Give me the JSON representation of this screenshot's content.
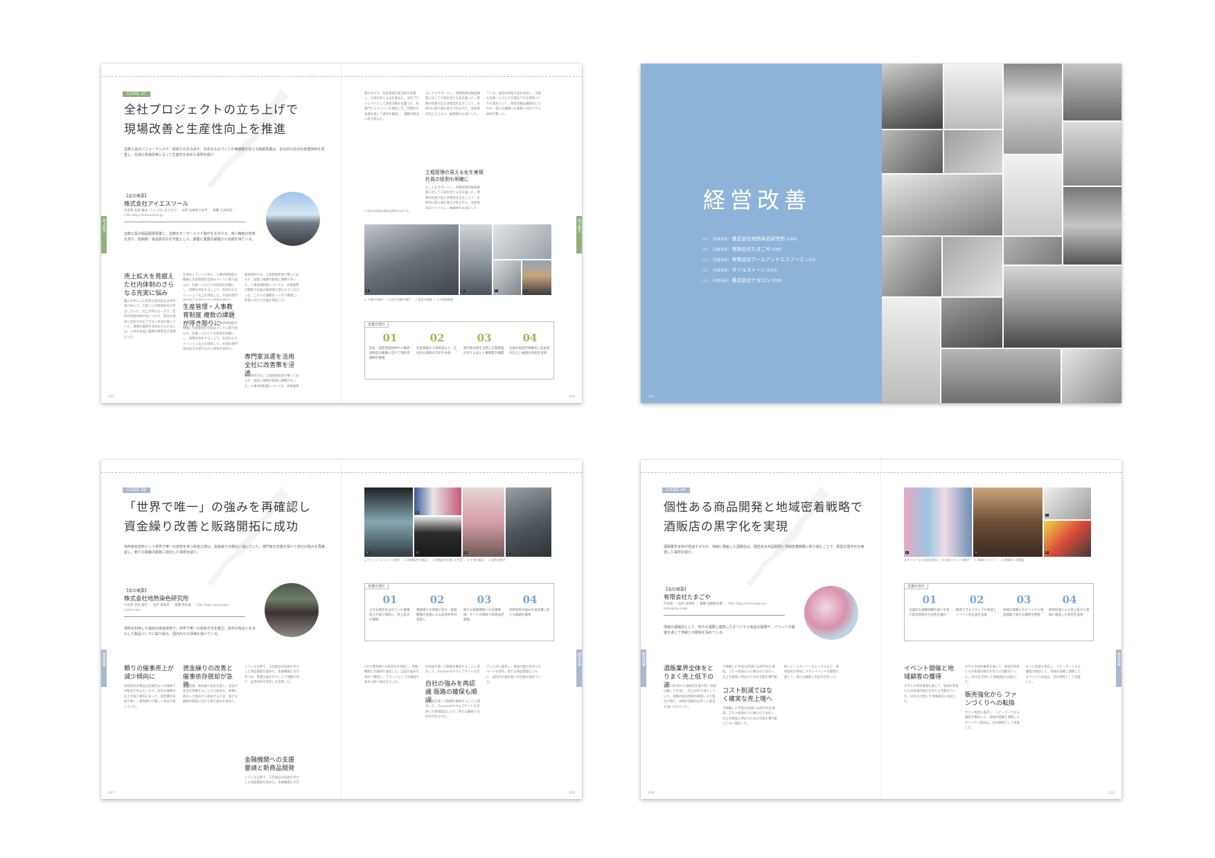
{
  "spread1": {
    "case_label": "CASE 37",
    "title_line1": "全社プロジェクトの立ち上げで",
    "title_line2": "現場改善と生産性向上を推進",
    "lead": "宝飾工具のパフォーマンスや、技術力の生み出す、日本のものづくりの価値観を伝える取組事業は、全社的な社内の管理体制を見直し、社員の意識改革によって生産性を高めた事例を紹介",
    "company_label": "【会社概要】",
    "company_name": "株式会社アイエスツール",
    "company_details": "代表者 石塚 雅永 / いしづか まさなが ｜ 住所 兵庫県三木市 ｜ 業種 工具製造 ｜ URL http://www.istool.jp",
    "business_desc": "宝飾工具の製品開発事業と、宝飾のオーダーメイド製作を手がける。高い精度の技術を誇り、短納期・高品質対応を可能とした。顧客に業務の顧客から信頼を得ている。",
    "heading_a": "売上拡大を見据えた社内体制のさらなる充実に悩み",
    "heading_b": "生産管理・人事教育制度 複数の課題が浮き彫りに",
    "heading_c": "専門家派遣を活用 全社に改善策を浸透",
    "heading_d": "工程管理の見える化を実現 社員の役割も明確に",
    "body_a": "職人の手による宝飾工具の組立は手作業が中心で、工程ごとの情報共有が不足していた。売上が伸びる一方で、社内の管理体制が追いつかず、受注の増加に生産が対応できない状況が続いていた。現場の業務を効率化するためには、人材の育成と業務の標準化が急務だった。",
    "body_b": "を伸ばしていくために、人事評価制度の整備と生産管理の仕組みづくりに取り組んだ。社員一人ひとりの役割を明確にし、目標を共有することで、社内のモチベーション向上を目指した。外部の専門家の助言を受けながら改善を進めた。",
    "body_c": "管理体制では、工程管理体制が整っておらず、品質と納期の管理に課題があった。人事評価制度についても、評価基準が曖昧で社員の納得感を得られていなかった。これらの課題を一つずつ整理し、改善に向けた計画を策定した。",
    "body_d": "進むなかで、生産管理の担当者を配置し、工程の見える化を進めた。全社プロジェクトとして改善活動を位置づけ、各部門からメンバーを選出した。定期的な会議を通じて進捗を確認し、課題の解決に取り組んだ。",
    "body_e": "ることもサポートし、現場改善の推進事業に対して工程の見える化を図った。現場の社員が自ら改善案を出すことで、主体的に取り組む風土が生まれた。生産性の向上とともに、納期遅れも減少した。",
    "body_f": "ている。会社の目指す姿を共有し、今後も社員一人ひとりが成長できる環境づくりを進めていく。改善活動は継続的に行われ、新たな課題にも柔軟に対応できる体制が整った。",
    "photo_caption": "A 工場内の様子 ｜ B 加工作業の様子 ｜ C 製品の検査 ｜ D 代表取締役",
    "footnote": "※本文の内容は取材当時のものです。",
    "flow_label": "支援の流れ",
    "steps": [
      {
        "num": "01",
        "text": "生産・品質管理体制や人事評価制度の整備に向けて現状の課題を整理"
      },
      {
        "num": "02",
        "text": "生産管理や人材育成など、全社的な取組の方針を共有"
      },
      {
        "num": "03",
        "text": "専門家派遣を活用し工程管理の見える化と人事制度を構築"
      },
      {
        "num": "04",
        "text": "社員の役割が明確化し生産性の向上と納期の改善を実現"
      }
    ],
    "side_tab_left": "売上拡大",
    "side_tab_right": "売上拡大",
    "page_left": "103",
    "page_right": "104"
  },
  "spread2": {
    "heading": "経営改善",
    "cases": [
      {
        "page": "107",
        "tag": "［事業事例］",
        "name": "株式会社地熱染色研究所",
        "pref": "青森県"
      },
      {
        "page": "109",
        "tag": "［事業事例］",
        "name": "有限会社たまごや",
        "pref": "長崎県"
      },
      {
        "page": "111",
        "tag": "［事業事例］",
        "name": "有限会社アールアンドエスフーズ",
        "pref": "山形県"
      },
      {
        "page": "113",
        "tag": "［事業事例］",
        "name": "サイルストーン",
        "pref": "熊本県"
      },
      {
        "page": "115",
        "tag": "［事業事例］",
        "name": "株式会社ナダロン",
        "pref": "愛知県"
      }
    ],
    "page_left": "105"
  },
  "spread3": {
    "case_label": "CASE 38",
    "title_line1": "「世界で唯一」の強みを再確認し",
    "title_line2": "資金繰り改善と販路開拓に成功",
    "lead": "地熱染色技術という世界で唯一の技術を持つ染色工房は、資金繰りの悪化に悩んでいた。専門家の支援を受けて自社の強みを再確認し、新たな販路の開拓に成功した事例を紹介。",
    "company_label": "【会社概要】",
    "company_name": "株式会社地熱染色研究所",
    "company_details": "代表者 菅原 康行 ｜ 住所 青森県 ｜ 業種 染色業 ｜ URL http://www.geo-color.com/",
    "business_desc": "地熱を利用した独自の染色技術で、世界で唯一の染色方法を確立。自然の色合いを活かした製品づくりに取り組み、国内外から評価を受けている。",
    "heading_a": "頼りの催事売上が減少傾向に",
    "heading_b": "資金繰りの改善と催事依存脱却が急務",
    "heading_c": "金融機関への支援要請と新商品開発",
    "heading_d": "自社の強みを再認識 販路の確保も順調",
    "body_a": "地熱染色の製品は百貨店などの催事での販売が中心だったが、近年は催事の売上が減少傾向にあった。固定費の負担が重く、資金繰りが厳しい状況が続いていた。",
    "body_b": "その結果、資金繰り表を作成し、収支の状況を把握することから始めた。催事に依存した販売から脱却するため、新たな販路の開拓に向けた取り組みを進めた。",
    "body_c": "している分野で、工房独自の技術を活かした商品開発を進めた。金融機関との交渉では、事業計画を示すことで理解を得て、返済条件の見直しを実現した。",
    "body_d": "1まず資金繰りの安定化を目指し、金融機関との関係を強化した。自社の強みを改めて整理し、ブランドとしての価値を高める取り組みを行った。",
    "body_e": "の商品を使って販路を確保することに成功した。Facebookやウェブサイトを活用した情報発信により、新たな顧客との接点が生まれた。",
    "body_f": "アした点に着目し、製品の魅力を伝えるページを制作。新たな商品開発とともに、国内外の展示会への出展も進めている。",
    "photo_caption": "A ファッションショーの様子 ｜ B 地熱染色の製品 ｜ C 地熱染色を施した作品 ｜ D 工房の製品 ｜ E 染色の様子",
    "flow_label": "支援の流れ",
    "steps": [
      {
        "num": "01",
        "text": "大きな割合を占めていた催事売上が減少傾向に、売上拡大の課題"
      },
      {
        "num": "02",
        "text": "資金繰りの改善に向け、金融機関の支援による返済条件の見直し"
      },
      {
        "num": "03",
        "text": "新たな販路開拓への支援要請、サイトの刷新で新商品の開発"
      },
      {
        "num": "04",
        "text": "地熱染色の強みを再認識し新たな販路を確保"
      }
    ],
    "side_tab": "経営改善",
    "page_left": "107",
    "page_right": "108"
  },
  "spread4": {
    "case_label": "CASE 40",
    "title_line1": "個性ある商品開発と地域密着戦略で",
    "title_line2": "酒販店の黒字化を実現",
    "lead": "酒販業界全体が低迷するなか、地域に根差した酒販店は、個性ある商品開発と地域密着戦略に取り組むことで、経営の黒字化を実現した事例を紹介。",
    "company_label": "【会社概要】",
    "company_name": "有限会社たまごや",
    "company_details": "代表者 ｜ 住所 長崎県 ｜ 業種 酒類販売業 ｜ URL http://www.sake-no-tamagoya.com/",
    "business_desc": "地域の酒販店として、地元の酒蔵と連携したオリジナル商品の開発や、イベントの開催を通じて地域との関係を深めている。",
    "heading_a": "酒販業界全体をとりまく売上低下の波",
    "heading_b": "コスト削減ではなく確実な売上増へ",
    "heading_c": "イベント開催と地域顧客の獲得",
    "heading_d": "販売強化から ファンづくりへの転換",
    "body_a": "平成20年頃から酒販店を取り巻く環境は厳しさを増し、売上は年々減少していた。酒類の販売規制の緩和により競合が増え、地域の酒販店は苦しい経営を強いられていた。",
    "body_b": "が掲載した平成28年度には黒字化を達成。コスト削減だけに頼るのではなく、売上を確実に伸ばすための方策を専門家とともに検討した。",
    "body_c": "他しビールサーバーのレンタルなど、地域住民が参加しやすいイベントの開催を通じて、新たな顧客との接点を作った。",
    "body_d": "大学との共同事業を通じて、地域の若者にも日本酒の魅力を伝える活動を行った。SNSを活用した情報発信も強化した。",
    "body_e": "すぐに何度も来店し、リピーターとなる顧客が増加した。地域の酒蔵と連携したオリジナル商品は、店の個性として定着した。",
    "photo_caption": "A オリジナル日本酒の商品 ｜ B 店内イベントの様子 ｜ C 地域のイベント ｜ D 地域誌への掲載",
    "flow_label": "支援の流れ",
    "steps": [
      {
        "num": "01",
        "text": "全国的な酒類消費の減少を受け経営改善の方向性を検討"
      },
      {
        "num": "02",
        "text": "販売できるスタッフの育成とイベントの企画を実施"
      },
      {
        "num": "03",
        "text": "地域の酒蔵とのオリジナル商品開発で新たな顧客を開拓"
      },
      {
        "num": "04",
        "text": "販売促進による売上拡大と地域に根差した経営を実現"
      }
    ],
    "side_tab": "経営改善",
    "page_left": "109",
    "page_right": "110"
  },
  "colors": {
    "green": "#8fb07a",
    "blue": "#8eb3d8",
    "slate": "#a7b9cc",
    "step_num_green": "#a4b650",
    "step_num_blue": "#7ea6cf"
  }
}
